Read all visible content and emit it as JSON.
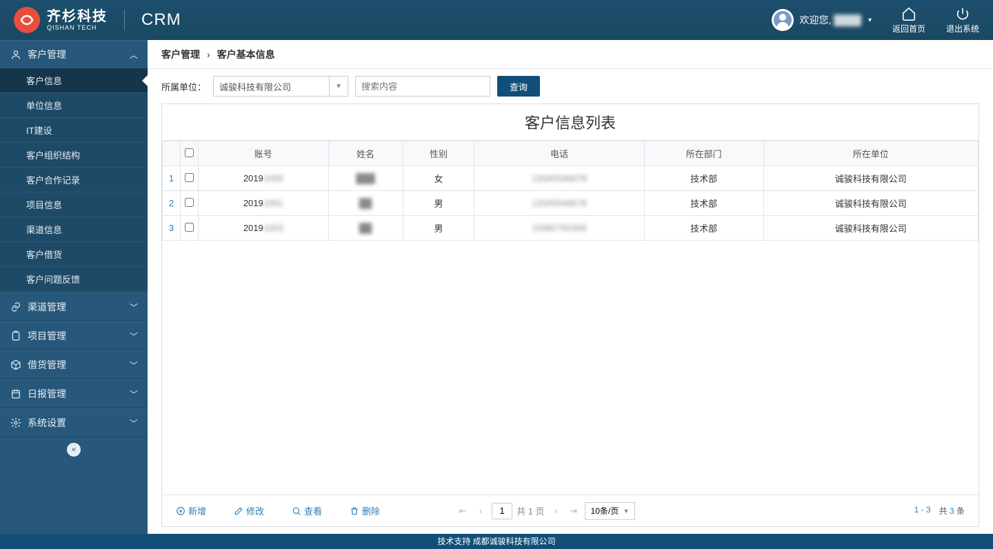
{
  "header": {
    "logo_cn": "齐杉科技",
    "logo_en": "QISHAN TECH",
    "app_name": "CRM",
    "welcome_prefix": "欢迎您,",
    "welcome_name": "████",
    "home_label": "返回首页",
    "logout_label": "退出系统"
  },
  "sidebar": {
    "groups": [
      {
        "label": "客户管理",
        "expanded": true,
        "items": [
          {
            "label": "客户信息",
            "active": true
          },
          {
            "label": "单位信息"
          },
          {
            "label": "IT建设"
          },
          {
            "label": "客户组织结构"
          },
          {
            "label": "客户合作记录"
          },
          {
            "label": "项目信息"
          },
          {
            "label": "渠道信息"
          },
          {
            "label": "客户借货"
          },
          {
            "label": "客户问题反馈"
          }
        ]
      },
      {
        "label": "渠道管理",
        "expanded": false
      },
      {
        "label": "项目管理",
        "expanded": false
      },
      {
        "label": "借货管理",
        "expanded": false
      },
      {
        "label": "日报管理",
        "expanded": false
      },
      {
        "label": "系统设置",
        "expanded": false
      }
    ]
  },
  "breadcrumb": {
    "root": "客户管理",
    "current": "客户基本信息"
  },
  "toolbar": {
    "unit_label": "所属单位：",
    "unit_selected": "诚骏科技有限公司",
    "search_placeholder": "搜索内容",
    "query_btn": "查询"
  },
  "panel": {
    "title": "客户信息列表",
    "columns": [
      "账号",
      "姓名",
      "性别",
      "电话",
      "所在部门",
      "所在单位"
    ],
    "rows": [
      {
        "idx": "1",
        "account_prefix": "2019",
        "account_blur": "1005",
        "name_blur": "███",
        "gender": "女",
        "phone_blur": "13345546678",
        "dept": "技术部",
        "unit": "诚骏科技有限公司"
      },
      {
        "idx": "2",
        "account_prefix": "2019",
        "account_blur": "1001",
        "name_blur": "██",
        "gender": "男",
        "phone_blur": "13345546678",
        "dept": "技术部",
        "unit": "诚骏科技有限公司"
      },
      {
        "idx": "3",
        "account_prefix": "2019",
        "account_blur": "1003",
        "name_blur": "██",
        "gender": "男",
        "phone_blur": "15982760306",
        "dept": "技术部",
        "unit": "诚骏科技有限公司"
      }
    ]
  },
  "footer_actions": {
    "add": "新增",
    "edit": "修改",
    "view": "查看",
    "delete": "删除"
  },
  "pager": {
    "page_input": "1",
    "page_total_prefix": "共 ",
    "page_total_num": "1",
    "page_total_suffix": " 页",
    "per_page": "10条/页",
    "range": "1 - 3",
    "total_prefix": "共 ",
    "total_num": "3",
    "total_suffix": " 条"
  },
  "app_footer": "技术支持 成都诚骏科技有限公司"
}
